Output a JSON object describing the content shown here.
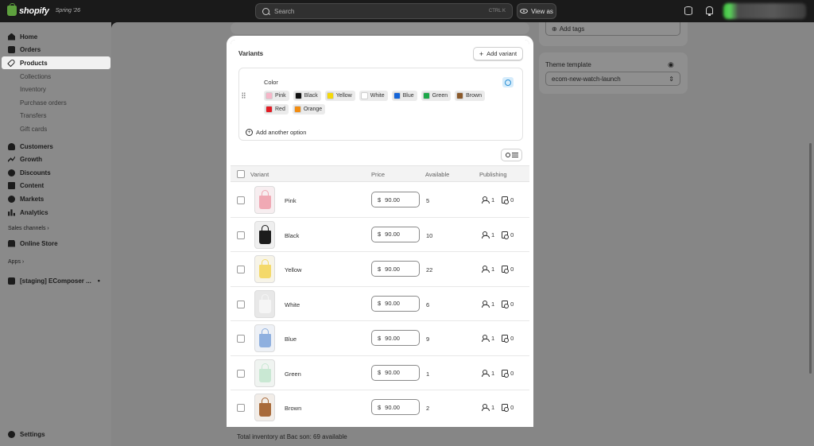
{
  "topbar": {
    "brand": "shopify",
    "edition": "Spring '26",
    "search_placeholder": "Search",
    "search_shortcut": "CTRL K",
    "view_as_label": "View as"
  },
  "sidebar": {
    "items": [
      {
        "label": "Home"
      },
      {
        "label": "Orders"
      },
      {
        "label": "Products"
      },
      {
        "label": "Collections"
      },
      {
        "label": "Inventory"
      },
      {
        "label": "Purchase orders"
      },
      {
        "label": "Transfers"
      },
      {
        "label": "Gift cards"
      },
      {
        "label": "Customers"
      },
      {
        "label": "Growth"
      },
      {
        "label": "Discounts"
      },
      {
        "label": "Content"
      },
      {
        "label": "Markets"
      },
      {
        "label": "Analytics"
      }
    ],
    "sales_channels_label": "Sales channels",
    "online_store_label": "Online Store",
    "apps_label": "Apps",
    "app_item_label": "[staging] EComposer ...",
    "settings_label": "Settings"
  },
  "background": {
    "add_tags_label": "Add tags",
    "theme_template_label": "Theme template",
    "theme_template_value": "ecom-new-watch-launch",
    "footer_text": "Total inventory at Bac son: 69 available"
  },
  "variants": {
    "title": "Variants",
    "add_variant_label": "Add variant",
    "option_name": "Color",
    "option_values": [
      {
        "label": "Pink",
        "color": "#f6b6c8"
      },
      {
        "label": "Black",
        "color": "#111111"
      },
      {
        "label": "Yellow",
        "color": "#f5d90a"
      },
      {
        "label": "White",
        "color": "#ffffff"
      },
      {
        "label": "Blue",
        "color": "#1565d8"
      },
      {
        "label": "Green",
        "color": "#1ea84a"
      },
      {
        "label": "Brown",
        "color": "#8b5a2b"
      },
      {
        "label": "Red",
        "color": "#e31b23"
      },
      {
        "label": "Orange",
        "color": "#f28c0f"
      }
    ],
    "add_option_label": "Add another option",
    "columns": {
      "variant": "Variant",
      "price": "Price",
      "available": "Available",
      "publishing": "Publishing"
    },
    "rows": [
      {
        "name": "Pink",
        "currency": "$",
        "price": "90.00",
        "available": "5",
        "pub_a": "1",
        "pub_b": "0",
        "bag_color": "#f0a9b4",
        "bg": "#f7eef0"
      },
      {
        "name": "Black",
        "currency": "$",
        "price": "90.00",
        "available": "10",
        "pub_a": "1",
        "pub_b": "0",
        "bag_color": "#1c1c1c",
        "bg": "#efefef"
      },
      {
        "name": "Yellow",
        "currency": "$",
        "price": "90.00",
        "available": "22",
        "pub_a": "1",
        "pub_b": "0",
        "bag_color": "#f4d96a",
        "bg": "#f7f4e8"
      },
      {
        "name": "White",
        "currency": "$",
        "price": "90.00",
        "available": "6",
        "pub_a": "1",
        "pub_b": "0",
        "bag_color": "#f5f5f5",
        "bg": "#e8e8e8"
      },
      {
        "name": "Blue",
        "currency": "$",
        "price": "90.00",
        "available": "9",
        "pub_a": "1",
        "pub_b": "0",
        "bag_color": "#8fb0df",
        "bg": "#eef1f6"
      },
      {
        "name": "Green",
        "currency": "$",
        "price": "90.00",
        "available": "1",
        "pub_a": "1",
        "pub_b": "0",
        "bag_color": "#c9e8d3",
        "bg": "#f0f4f1"
      },
      {
        "name": "Brown",
        "currency": "$",
        "price": "90.00",
        "available": "2",
        "pub_a": "1",
        "pub_b": "0",
        "bag_color": "#a86a3a",
        "bg": "#f2ede8"
      }
    ]
  }
}
